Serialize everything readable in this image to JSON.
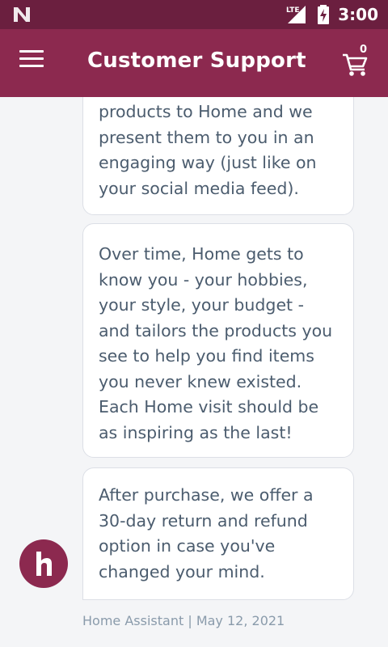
{
  "status_bar": {
    "time": "3:00",
    "network": "LTE",
    "icons": [
      "notification-n-icon",
      "signal-icon",
      "battery-charging-icon"
    ]
  },
  "header": {
    "title": "Customer Support",
    "menu_icon": "hamburger-menu-icon",
    "cart_icon": "shopping-cart-icon",
    "cart_count": "0"
  },
  "messages": [
    {
      "text": "products to Home and we\npresent them to you in an\nengaging way (just like on\nyour social media feed)."
    },
    {
      "text": "Over time, Home gets to\nknow you - your hobbies,\nyour style, your budget -\nand tailors the products you\nsee to help you find items\nyou never knew existed.\nEach Home visit should be\nas inspiring as the last!"
    },
    {
      "text": "After purchase, we offer a\n30-day return and refund\noption in case you've\nchanged your mind."
    }
  ],
  "message_meta": {
    "sender": "Home Assistant",
    "separator": "|",
    "date": "May 12, 2021"
  },
  "colors": {
    "status_bar": "#6b1f3f",
    "app_bar": "#8c294f",
    "avatar": "#8c294f",
    "bubble_text": "#4b5c6e",
    "meta_text": "#8a9bab",
    "background": "#f4f5f7"
  }
}
